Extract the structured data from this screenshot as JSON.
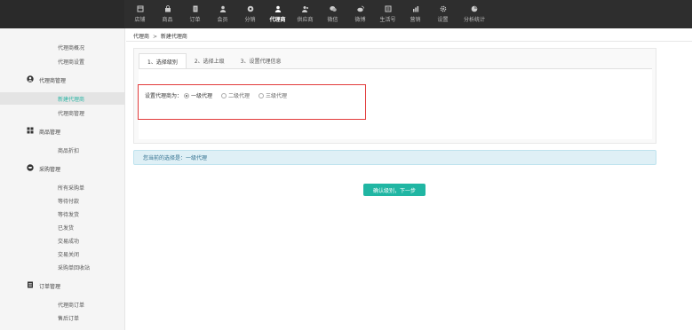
{
  "nav": {
    "items": [
      {
        "label": "店铺",
        "icon": "store-icon"
      },
      {
        "label": "商品",
        "icon": "bag-icon"
      },
      {
        "label": "订单",
        "icon": "order-icon"
      },
      {
        "label": "会员",
        "icon": "member-icon"
      },
      {
        "label": "分销",
        "icon": "distribution-icon"
      },
      {
        "label": "代理商",
        "icon": "agent-icon",
        "active": true
      },
      {
        "label": "供应商",
        "icon": "supplier-icon"
      },
      {
        "label": "微信",
        "icon": "wechat-icon"
      },
      {
        "label": "微博",
        "icon": "weibo-icon"
      },
      {
        "label": "生活号",
        "icon": "life-icon"
      },
      {
        "label": "营销",
        "icon": "marketing-icon"
      },
      {
        "label": "设置",
        "icon": "gear-icon"
      },
      {
        "label": "分析统计",
        "icon": "analytics-icon"
      }
    ]
  },
  "sidebar": {
    "agent_overview": "代理商概况",
    "agent_settings": "代理商设置",
    "agent_mgmt_head": "代理商管理",
    "new_agent": "新建代理商",
    "agent_mgmt": "代理商管理",
    "goods_mgmt_head": "商品管理",
    "goods_discount": "商品折扣",
    "purchase_mgmt_head": "采购管理",
    "all_purchase": "所有采购单",
    "wait_pay": "等待付款",
    "wait_ship": "等待发货",
    "shipped": "已发货",
    "deal_success": "交易成功",
    "deal_closed": "交易关闭",
    "purchase_recycle": "采购单回收站",
    "order_mgmt_head": "订单管理",
    "agent_orders": "代理商订单",
    "after_sale": "售后订单"
  },
  "breadcrumb": {
    "parent": "代理商",
    "separator": ">",
    "current": "新建代理商"
  },
  "tabs": [
    {
      "label": "1、选择级别"
    },
    {
      "label": "2、选择上级"
    },
    {
      "label": "3、设置代理信息"
    }
  ],
  "form": {
    "label": "设置代理商为：",
    "options": [
      "一级代理",
      "二级代理",
      "三级代理"
    ]
  },
  "info": {
    "text": "您当前的选择是：一级代理"
  },
  "confirm": {
    "label": "确认级别，下一步"
  }
}
